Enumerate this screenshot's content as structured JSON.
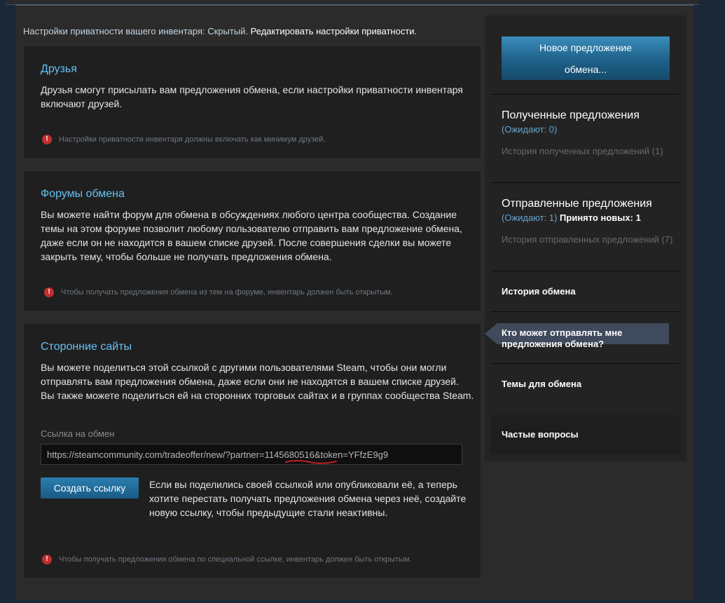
{
  "privacy": {
    "text": "Настройки приватности вашего инвентаря: Скрытый.",
    "link": "Редактировать настройки приватности."
  },
  "friends": {
    "title": "Друзья",
    "desc": "Друзья смогут присылать вам предложения обмена, если настройки приватности инвентаря включают друзей.",
    "warning": "Настройки приватности инвентаря должны включать как минимум друзей."
  },
  "forums": {
    "title": "Форумы обмена",
    "desc": "Вы можете найти форум для обмена в обсуждениях любого центра сообщества. Создание темы на этом форуме позволит любому пользователю отправить вам предложение обмена, даже если он не находится в вашем списке друзей. После совершения сделки вы можете закрыть тему, чтобы больше не получать предложения обмена.",
    "warning": "Чтобы получать предложения обмена из тем на форуме, инвентарь должен быть открытым."
  },
  "thirdparty": {
    "title": "Сторонние сайты",
    "desc": "Вы можете поделиться этой ссылкой с другими пользователями Steam, чтобы они могли отправлять вам предложения обмена, даже если они не находятся в вашем списке друзей. Вы также можете поделиться ей на сторонних торговых сайтах и в группах сообщества Steam.",
    "link_label": "Ссылка на обмен",
    "link_url": "https://steamcommunity.com/tradeoffer/new/?partner=1145680516&token=YFfzE9g9",
    "create_button": "Создать ссылку",
    "create_note": "Если вы поделились своей ссылкой или опубликовали её, а теперь хотите перестать получать предложения обмена через неё, создайте новую ссылку, чтобы предыдущие стали неактивны.",
    "warning": "Чтобы получать предложения обмена по специальной ссылке, инвентарь должен быть открытым."
  },
  "sidebar": {
    "new_offer_line1": "Новое предложение",
    "new_offer_line2": "обмена...",
    "received_title": "Полученные предложения",
    "received_pending": "(Ожидают: 0)",
    "received_history": "История полученных предложений (1)",
    "sent_title": "Отправленные предложения",
    "sent_pending": "(Ожидают: 1)",
    "sent_accepted": "Принято новых: 1",
    "sent_history": "История отправленных предложений (7)",
    "trade_history": "История обмена",
    "who_can_send": "Кто может отправлять мне предложения обмена?",
    "trade_topics": "Темы для обмена",
    "faq": "Частые вопросы"
  },
  "colors": {
    "accent_link": "#66c0f4",
    "panel": "#1f1f1f",
    "background": "#2b2b2b",
    "warning_icon": "#c22f2f",
    "button_blue": "#1e6189"
  },
  "icons": {
    "warning": "exclamation-circle-icon",
    "active_pointer": "left-arrow-icon"
  }
}
